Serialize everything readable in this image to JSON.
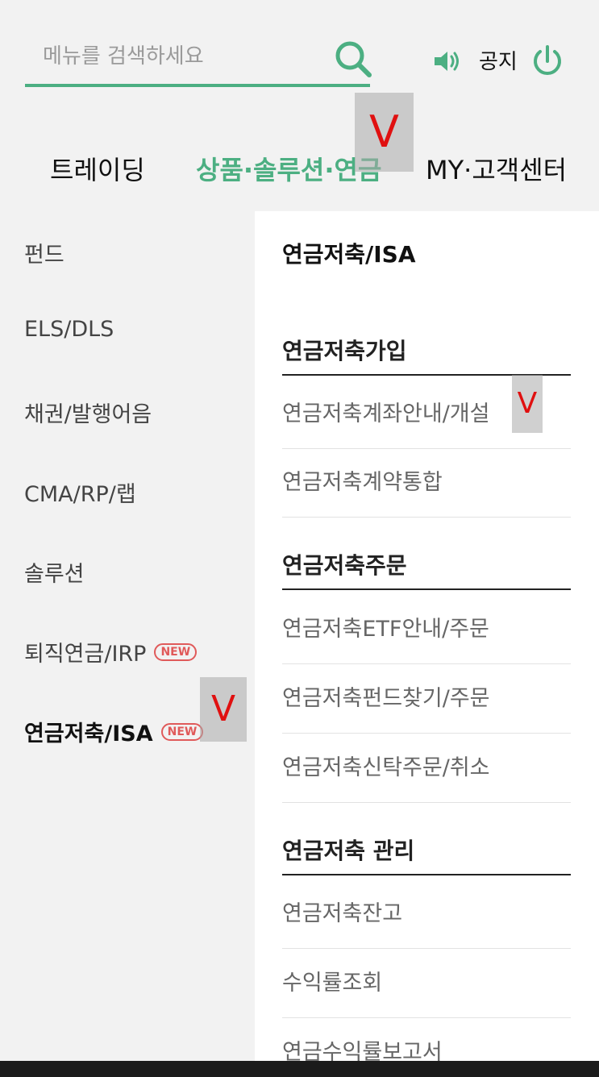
{
  "header": {
    "search_placeholder": "메뉴를 검색하세요",
    "notice_label": "공지",
    "accent_color": "#4caf82"
  },
  "tabs": [
    {
      "label": "트레이딩"
    },
    {
      "label": "상품·솔루션·연금"
    },
    {
      "label": "MY·고객센터"
    }
  ],
  "annotations": {
    "mark": "V"
  },
  "left_menu": [
    {
      "label": "펀드"
    },
    {
      "label": "ELS/DLS"
    },
    {
      "label": "채권/발행어음"
    },
    {
      "label": "CMA/RP/랩"
    },
    {
      "label": "솔루션"
    },
    {
      "label": "퇴직연금/IRP",
      "badge": "NEW"
    },
    {
      "label": "연금저축/ISA",
      "badge": "NEW"
    }
  ],
  "panel": {
    "title": "연금저축/ISA",
    "sections": [
      {
        "title": "연금저축가입",
        "items": [
          "연금저축계좌안내/개설",
          "연금저축계약통합"
        ]
      },
      {
        "title": "연금저축주문",
        "items": [
          "연금저축ETF안내/주문",
          "연금저축펀드찾기/주문",
          "연금저축신탁주문/취소"
        ]
      },
      {
        "title": "연금저축 관리",
        "items": [
          "연금저축잔고",
          "수익률조회",
          "연금수익률보고서"
        ]
      }
    ]
  }
}
